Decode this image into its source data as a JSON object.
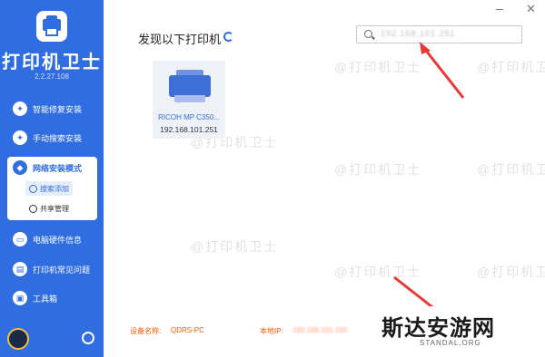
{
  "app": {
    "title": "打印机卫士",
    "version": "2.2.27.108",
    "brand_color": "#2f6de0"
  },
  "sidebar": {
    "items": [
      {
        "label": "智能修复安装",
        "icon": "wrench-icon"
      },
      {
        "label": "手动搜索安装",
        "icon": "wrench-icon"
      },
      {
        "label": "网络安装模式",
        "icon": "network-icon",
        "active": true
      },
      {
        "label": "电脑硬件信息",
        "icon": "monitor-icon"
      },
      {
        "label": "打印机常见问题",
        "icon": "printer-icon"
      },
      {
        "label": "工具箱",
        "icon": "toolbox-icon"
      }
    ],
    "subitems": [
      {
        "label": "搜索添加",
        "icon": "search-add-icon",
        "selected": true
      },
      {
        "label": "共享管理",
        "icon": "cloud-icon"
      }
    ]
  },
  "main": {
    "title": "发现以下打印机",
    "search_value": "192.168.101.251"
  },
  "printer": {
    "name": "RICOH MP C350...",
    "ip": "192.168.101.251"
  },
  "watermark_text": "@打印机卫士",
  "footer": {
    "device_label": "设备名称:",
    "device_value": "QDRS-PC",
    "ip_label": "本地IP:",
    "ip_value": "192.168.101.100"
  },
  "badge": {
    "main": "斯达安游网",
    "sub": "STANDAL.ORG"
  },
  "accent_color": "#e53935"
}
